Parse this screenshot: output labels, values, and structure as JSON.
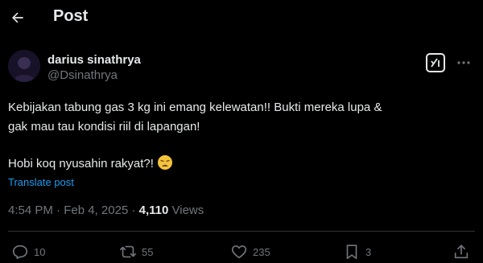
{
  "header": {
    "title": "Post",
    "back_icon": "arrow-left-icon"
  },
  "author": {
    "display_name": "darius sinathrya",
    "handle": "@Dsinathrya",
    "avatar_icon": "profile-avatar"
  },
  "post": {
    "line1": "Kebijakan tabung gas 3 kg ini emang kelewatan!! Bukti mereka lupa &",
    "line2": "gak mau tau kondisi riil di lapangan!",
    "line3": "Hobi koq nyusahin rakyat?!",
    "emoji": "weary-face-emoji",
    "translate_label": "Translate post"
  },
  "meta": {
    "time": "4:54 PM",
    "separator": "·",
    "date": "Feb 4, 2025",
    "views_count": "4,110",
    "views_label": "Views"
  },
  "actions": {
    "replies": "10",
    "reposts": "55",
    "likes": "235",
    "bookmarks": "3"
  },
  "colors": {
    "background": "#000000",
    "text": "#e7e9ea",
    "muted": "#71767b",
    "link": "#1d9bf0",
    "divider": "#2f3336"
  }
}
